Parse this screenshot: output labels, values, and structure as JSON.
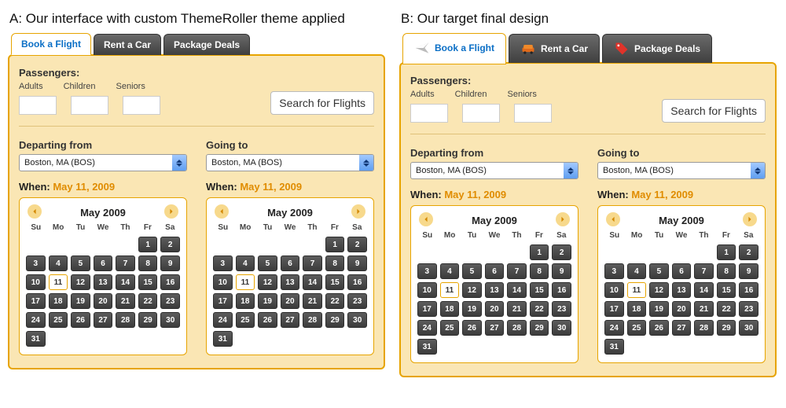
{
  "captions": {
    "a": "A: Our interface with custom ThemeRoller theme applied",
    "b": "B: Our target final design"
  },
  "tabs": [
    {
      "label": "Book a Flight",
      "icon": "plane-icon"
    },
    {
      "label": "Rent a Car",
      "icon": "car-icon"
    },
    {
      "label": "Package Deals",
      "icon": "tag-icon"
    }
  ],
  "passengers": {
    "title": "Passengers:",
    "labels": {
      "adults": "Adults",
      "children": "Children",
      "seniors": "Seniors"
    }
  },
  "searchBtn": "Search for Flights",
  "depart": {
    "title": "Departing from",
    "city": "Boston, MA (BOS)"
  },
  "going": {
    "title": "Going to",
    "city": "Boston, MA (BOS)"
  },
  "when": {
    "prefix": "When:",
    "date": "May 11, 2009"
  },
  "calendar": {
    "title": "May 2009",
    "dow": [
      "Su",
      "Mo",
      "Tu",
      "We",
      "Th",
      "Fr",
      "Sa"
    ],
    "firstDayOffset": 5,
    "daysInMonth": 31,
    "selected": 11
  }
}
